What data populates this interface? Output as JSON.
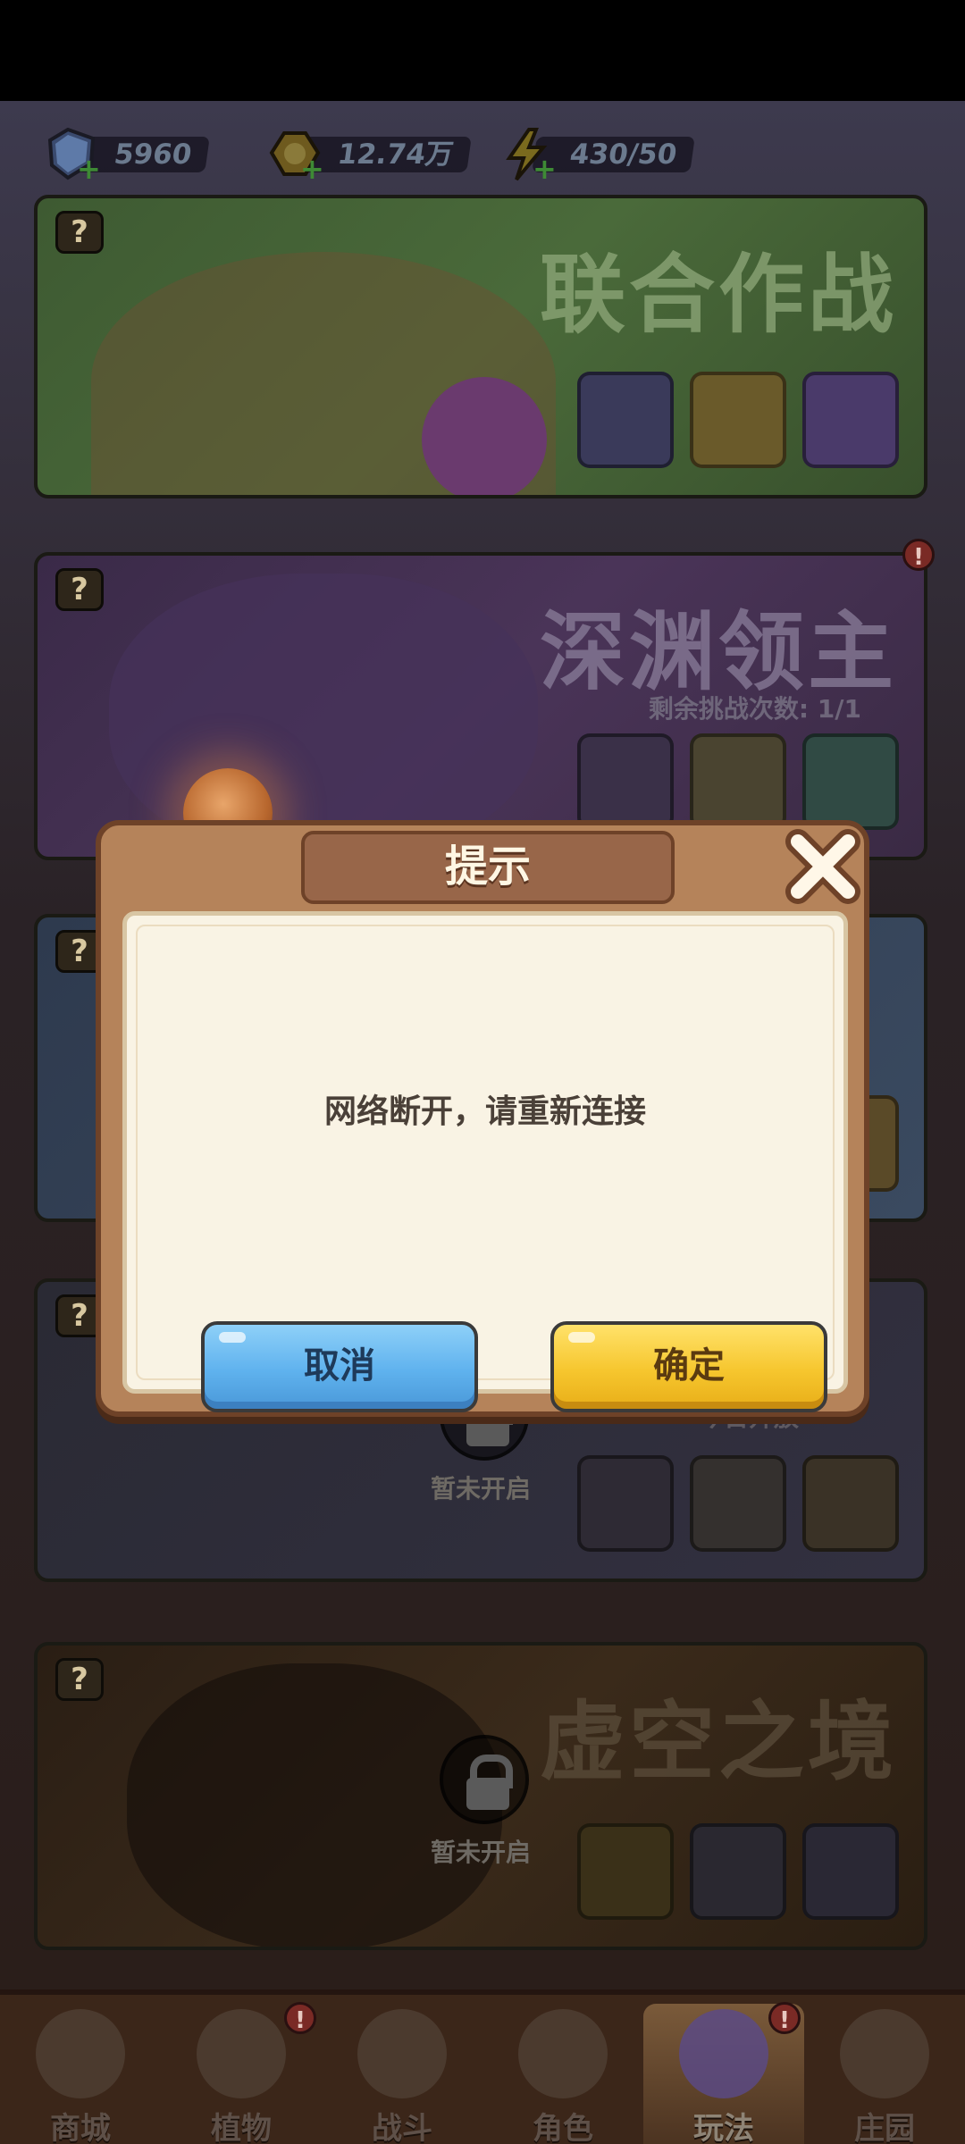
{
  "resources": {
    "gems": "5960",
    "gold": "12.74万",
    "energy": "430/50"
  },
  "modes": [
    {
      "title": "联合作战",
      "sub": ""
    },
    {
      "title": "深渊领主",
      "sub": "剩余挑战次数: 1/1"
    },
    {
      "title": "",
      "sub": ""
    },
    {
      "title": "",
      "sub": "今日开放",
      "locked": "暂未开启"
    },
    {
      "title": "虚空之境",
      "sub": "",
      "locked": "暂未开启"
    }
  ],
  "dialog": {
    "title": "提示",
    "message": "网络断开，请重新连接",
    "cancel": "取消",
    "confirm": "确定"
  },
  "nav": [
    {
      "label": "商城"
    },
    {
      "label": "植物"
    },
    {
      "label": "战斗"
    },
    {
      "label": "角色"
    },
    {
      "label": "玩法"
    },
    {
      "label": "庄园"
    }
  ],
  "colors": {
    "cancel_button": "#5fb2ee",
    "confirm_button": "#f6c62e",
    "dialog_frame": "#b5835a",
    "dialog_panel": "#f9f3e4"
  }
}
